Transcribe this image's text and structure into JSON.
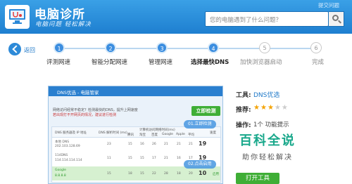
{
  "header": {
    "title": "电脑诊所",
    "slogan": "电脑问题 轻松解决",
    "search_placeholder": "您的电脑遇到了什么问题？",
    "feedback": "提交问题"
  },
  "nav": {
    "back": "返回"
  },
  "steps": [
    {
      "num": "1",
      "label": "评测网速",
      "state": "done"
    },
    {
      "num": "2",
      "label": "智能分配网速",
      "state": "done"
    },
    {
      "num": "3",
      "label": "管理网速",
      "state": "done"
    },
    {
      "num": "4",
      "label": "选择最快DNS",
      "state": "active"
    },
    {
      "num": "5",
      "label": "加快浏览器启动",
      "state": "todo"
    },
    {
      "num": "6",
      "label": "完成",
      "state": "todo"
    }
  ],
  "screenshot": {
    "window_title": "DNS优选 - 电脑管家",
    "intro_line1": "网络访问经常不稳定？检测最快的DNS，提升上网速度",
    "intro_line2": "若出现打不开网页的情况，建议进行检测",
    "detect_button": "立即检测",
    "columns": [
      "DNS 服务器及 IP 地址",
      "DNS 解析时间 (ms)",
      "腾讯",
      "淘宝",
      "百度",
      "Google",
      "Apple",
      "平均",
      "速度"
    ],
    "latency_header": "计算机访问网络时间(ms)",
    "rows": [
      {
        "name": "本地 DNS",
        "ip": "202.103.128.69",
        "resolve": "23",
        "t1": "15",
        "t2": "16",
        "t3": "26",
        "t4": "21",
        "t5": "21",
        "avg": "21",
        "score": "19"
      },
      {
        "name": "114DNS",
        "ip": "114.114.114.114",
        "resolve": "11",
        "t1": "15",
        "t2": "15",
        "t3": "17",
        "t4": "21",
        "t5": "16",
        "avg": "17",
        "score": "19"
      },
      {
        "name": "Google",
        "ip": "8.8.8.8",
        "resolve": "15",
        "t1": "18",
        "t2": "15",
        "t3": "22",
        "t4": "28",
        "t5": "18",
        "avg": "20",
        "score": "10",
        "action": "启用"
      }
    ],
    "callout1": "01.立即检测",
    "callout2": "02.点击启用"
  },
  "info": {
    "tool_label": "工具:",
    "tool_value": "DNS优选",
    "rating_label": "推荐:",
    "rating": 3,
    "rating_max": 5,
    "ops_label": "操作:",
    "ops_text": "1个 功能提示"
  },
  "watermark": {
    "logo": "百科全说",
    "sub": "助你轻松解决"
  },
  "open_button": "打开工具",
  "colors": {
    "header": "#2a88d8",
    "accent": "#3fae36",
    "link": "#1e78c8",
    "star": "#f4a300"
  }
}
